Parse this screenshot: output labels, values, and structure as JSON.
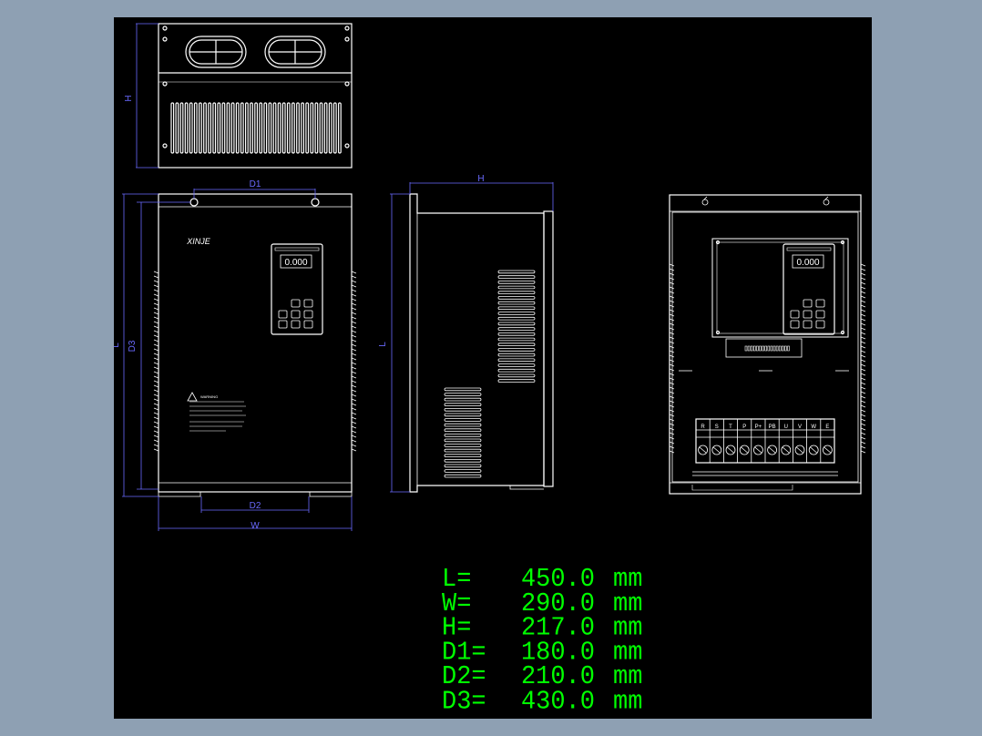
{
  "brand_label": "XINJE",
  "panel_display": "0.000",
  "warning_title": "WARNING",
  "dimension_labels": {
    "top_h": "H",
    "d1": "D1",
    "d3": "D3",
    "l_front": "L",
    "side_h": "H",
    "side_l": "L",
    "d2": "D2",
    "w": "W"
  },
  "terminals": [
    "R",
    "S",
    "T",
    "P",
    "P+",
    "PB",
    "U",
    "V",
    "W",
    "E"
  ],
  "dimensions": [
    {
      "label": "L=",
      "value": "450.0",
      "unit": "mm"
    },
    {
      "label": "W=",
      "value": "290.0",
      "unit": "mm"
    },
    {
      "label": "H=",
      "value": "217.0",
      "unit": "mm"
    },
    {
      "label": "D1=",
      "value": "180.0",
      "unit": "mm"
    },
    {
      "label": "D2=",
      "value": "210.0",
      "unit": "mm"
    },
    {
      "label": "D3=",
      "value": "430.0",
      "unit": "mm"
    }
  ],
  "colors": {
    "background_outer": "#8ea0b3",
    "canvas": "#000000",
    "outline": "#ffffff",
    "dimension_lines": "#6a6aff",
    "dimension_text": "#00ff00"
  }
}
